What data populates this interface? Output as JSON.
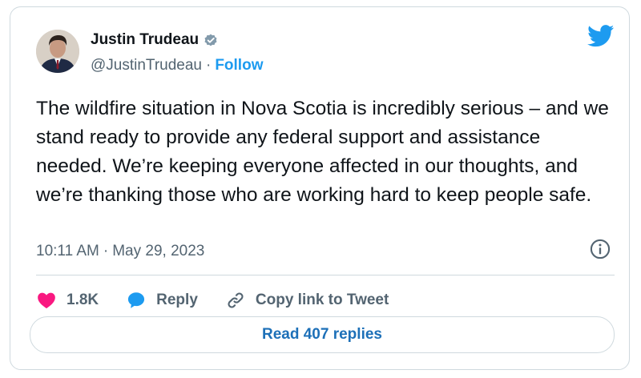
{
  "author": {
    "name": "Justin Trudeau",
    "handle": "@JustinTrudeau",
    "separator": "·",
    "follow_label": "Follow"
  },
  "tweet": {
    "text": "The wildfire situation in Nova Scotia is incredibly serious – and we stand ready to provide any federal support and assistance needed. We’re keeping everyone affected in our thoughts, and we’re thanking those who are working hard to keep people safe.",
    "time": "10:11 AM",
    "separator": "·",
    "date": "May 29, 2023"
  },
  "actions": {
    "likes_count": "1.8K",
    "reply_label": "Reply",
    "copy_link_label": "Copy link to Tweet"
  },
  "footer": {
    "read_replies_label": "Read 407 replies"
  },
  "icons": {
    "brand": "twitter-bird-icon",
    "verified": "verified-badge-icon",
    "info": "info-icon",
    "like": "heart-icon",
    "reply": "speech-bubble-icon",
    "copy": "link-icon"
  },
  "colors": {
    "accent": "#1d9bf0",
    "like": "#f91880",
    "text": "#0f1419",
    "muted": "#536471"
  }
}
